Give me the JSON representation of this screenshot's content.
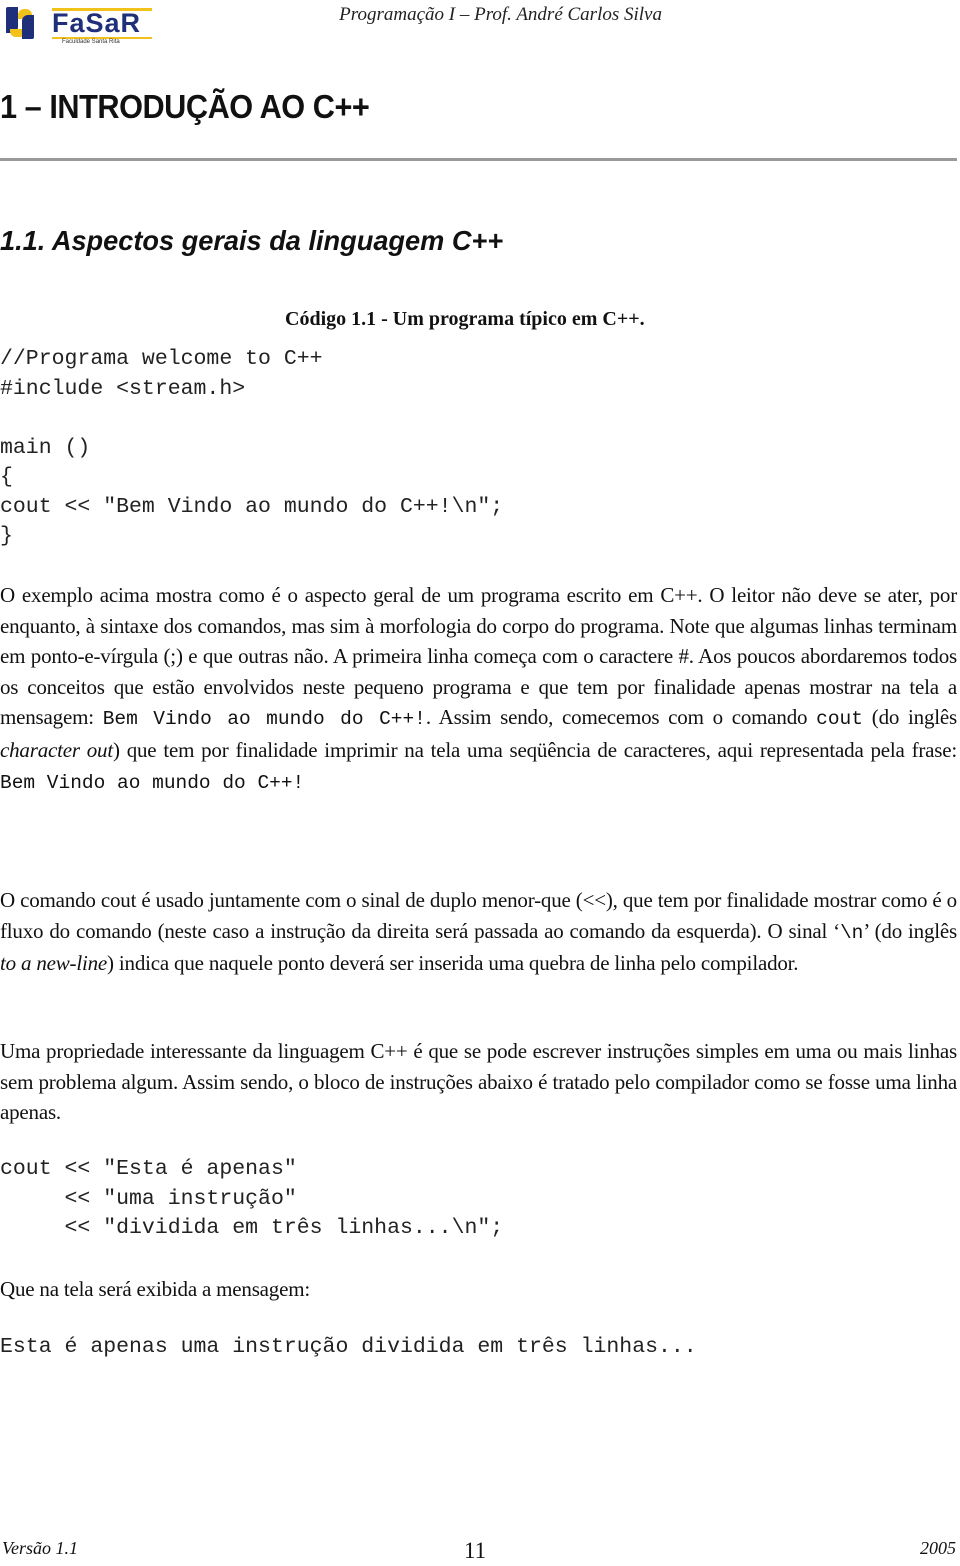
{
  "header": {
    "logo": {
      "name": "FaSaR",
      "subtitle": "Faculdade Santa Rita",
      "colors": {
        "blue": "#1f2f7a",
        "yellow": "#f2c21a"
      }
    },
    "course_title": "Programação I – Prof. André Carlos Silva"
  },
  "chapter": {
    "title": "1 – INTRODUÇÃO AO C++"
  },
  "section": {
    "title": "1.1. Aspectos gerais da linguagem C++"
  },
  "code_listing": {
    "caption": "Código 1.1 - Um programa típico em C++.",
    "lines": [
      "//Programa welcome to C++",
      "#include <stream.h>",
      "",
      "main ()",
      "{",
      "cout << \"Bem Vindo ao mundo do C++!\\n\";",
      "}"
    ]
  },
  "paragraph1": {
    "t1": "O exemplo acima mostra como é o aspecto geral de um programa escrito em C++. O leitor não deve se ater, por enquanto, à sintaxe dos comandos, mas sim à morfologia do corpo do programa. Note que algumas linhas terminam em ponto-e-vírgula (;) e que outras não. A primeira linha começa com o caractere #. Aos poucos abordaremos todos os conceitos que estão envolvidos neste pequeno programa e que tem por finalidade apenas mostrar na tela a mensagem: ",
    "code1": "Bem Vindo ao mundo do C++!",
    "t2": ". Assim sendo, comecemos com o comando ",
    "code2": "cout",
    "t3": " (do inglês ",
    "italic1": "character out",
    "t4": ") que tem por finalidade imprimir na tela uma seqüência de caracteres, aqui representada pela frase: ",
    "code3": "Bem Vindo ao mundo do C++!"
  },
  "paragraph2": {
    "t1": "O comando cout é usado juntamente com o sinal de duplo menor-que (<<), que tem por finalidade mostrar como é o fluxo do comando (neste caso a instrução da direita será passada ao comando da esquerda). O sinal ‘",
    "code1": "\\n",
    "t2": "’ (do inglês ",
    "italic1": "to a new-line",
    "t3": ") indica que naquele ponto deverá ser inserida uma quebra de linha pelo compilador."
  },
  "paragraph3": {
    "text": "Uma propriedade interessante da linguagem C++ é que se pode escrever instruções simples em uma ou mais linhas sem problema algum. Assim sendo, o bloco de instruções abaixo é tratado pelo compilador como se fosse uma linha apenas."
  },
  "code_listing2": {
    "lines": [
      "cout << \"Esta é apenas\"",
      "     << \"uma instrução\"",
      "     << \"dividida em três linhas...\\n\";"
    ]
  },
  "paragraph4": {
    "text": "Que na tela será exibida a mensagem:"
  },
  "output": {
    "text": "Esta é apenas uma instrução dividida em três linhas..."
  },
  "footer": {
    "version": "Versão 1.1",
    "page_number": "11",
    "year": "2005"
  }
}
